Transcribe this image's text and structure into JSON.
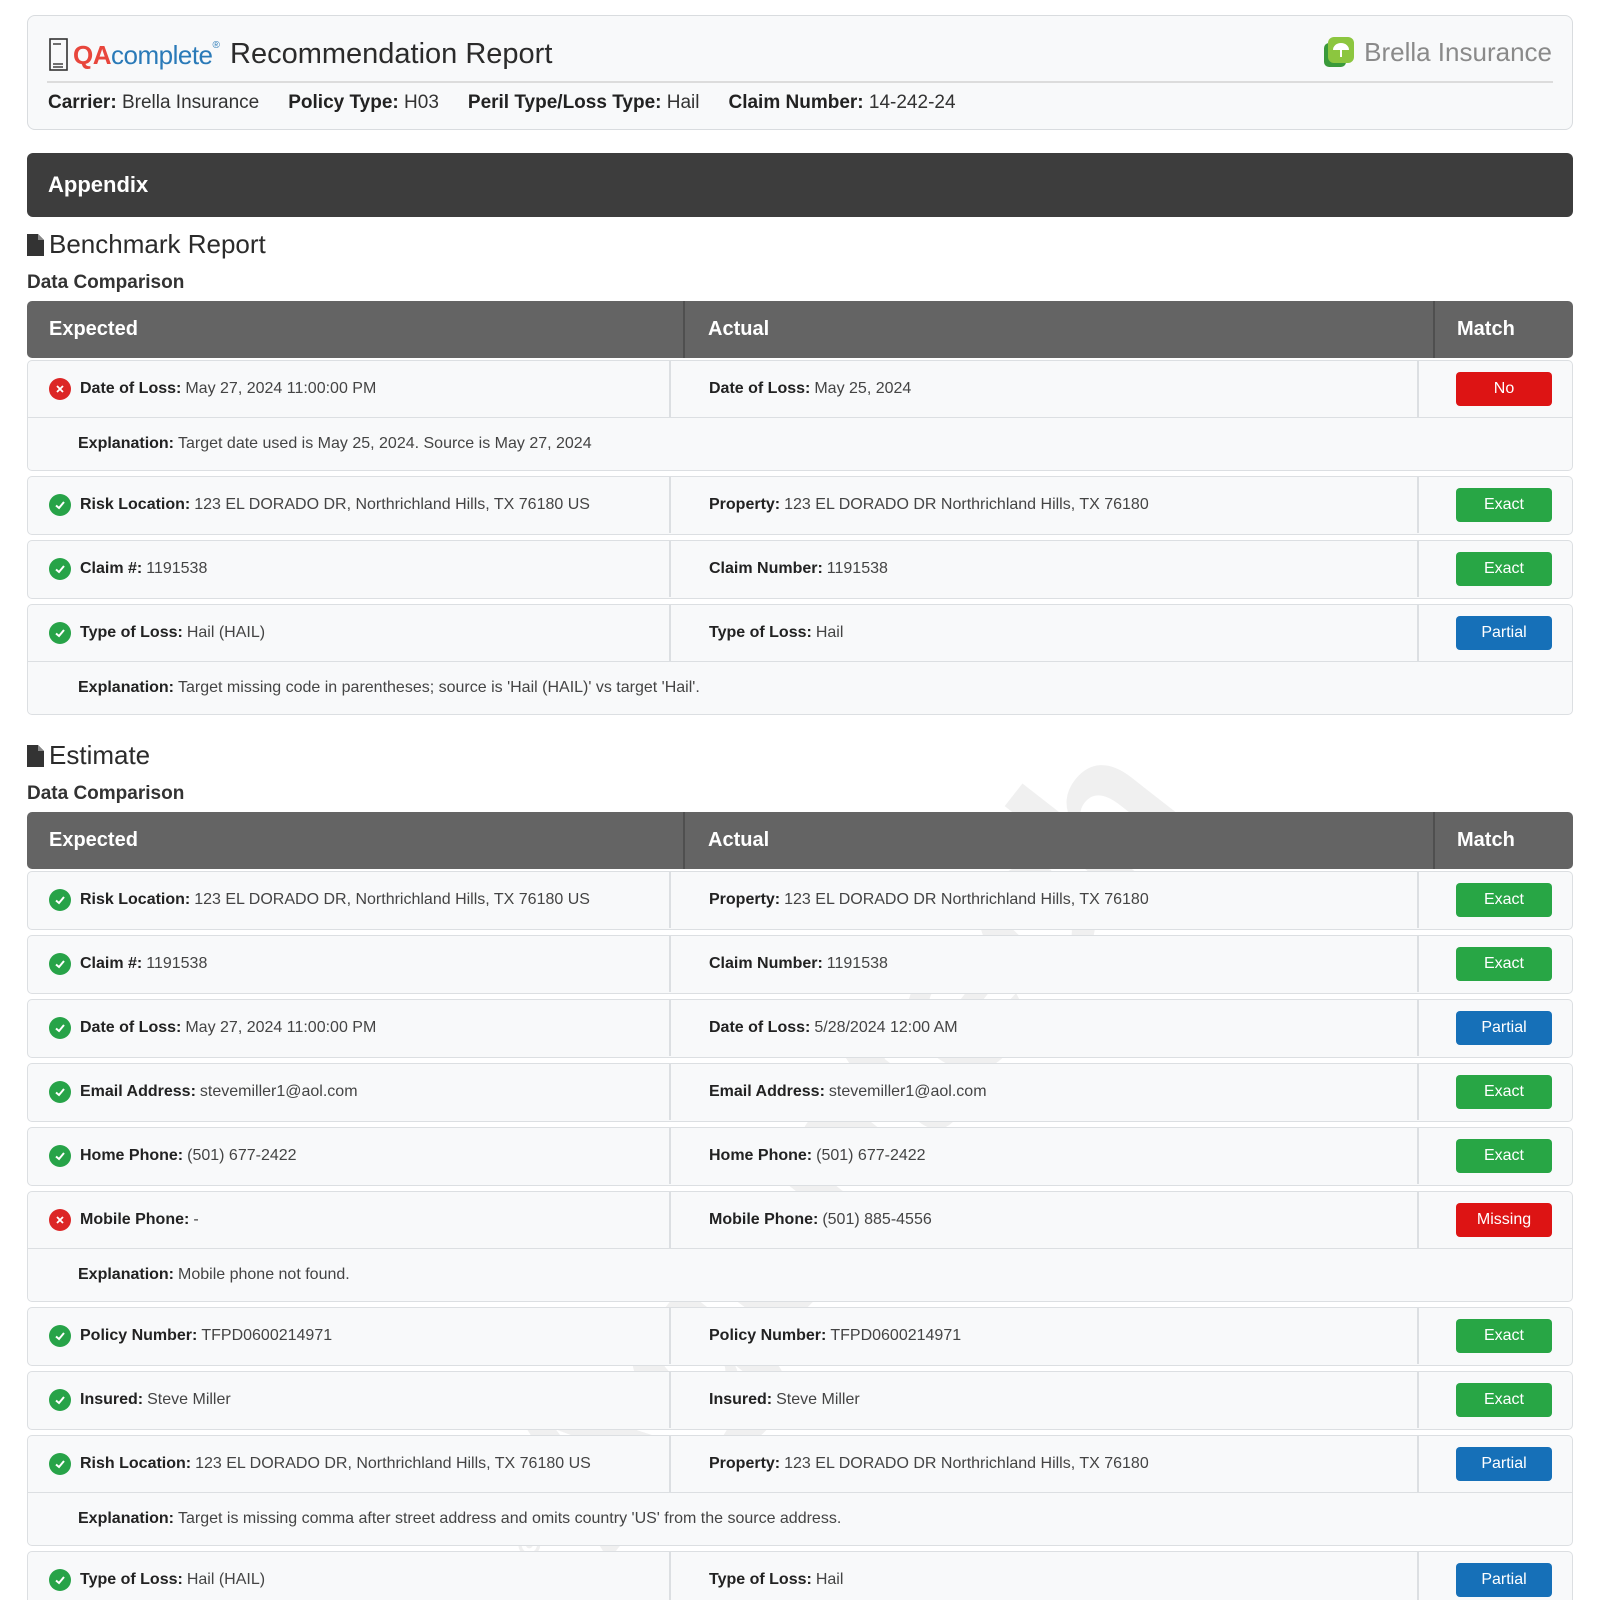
{
  "header": {
    "logo_qa": "QA",
    "logo_complete": "complete",
    "logo_reg": "®",
    "title": "Recommendation Report",
    "brand_name": "Brella Insurance",
    "meta": [
      {
        "label": "Carrier:",
        "value": "Brella Insurance"
      },
      {
        "label": "Policy Type:",
        "value": "H03"
      },
      {
        "label": "Peril Type/Loss Type:",
        "value": "Hail"
      },
      {
        "label": "Claim Number:",
        "value": "14-242-24"
      }
    ]
  },
  "appendix_title": "Appendix",
  "watermark_text": "Agentech",
  "columns": {
    "expected": "Expected",
    "actual": "Actual",
    "match": "Match"
  },
  "benchmark": {
    "title": "Benchmark Report",
    "subtitle": "Data Comparison",
    "rows": [
      {
        "status": "error",
        "exp_label": "Date of Loss:",
        "exp_value": "May 27, 2024 11:00:00 PM",
        "act_label": "Date of Loss:",
        "act_value": "May 25, 2024",
        "match": "No",
        "explanation_label": "Explanation:",
        "explanation": "Target date used is May 25, 2024. Source is May 27, 2024"
      },
      {
        "status": "ok",
        "exp_label": "Risk Location:",
        "exp_value": "123 EL DORADO DR, Northrichland Hills, TX 76180 US",
        "act_label": "Property:",
        "act_value": "123 EL DORADO DR Northrichland Hills, TX 76180",
        "match": "Exact"
      },
      {
        "status": "ok",
        "exp_label": "Claim #:",
        "exp_value": "1191538",
        "act_label": "Claim Number:",
        "act_value": "1191538",
        "match": "Exact"
      },
      {
        "status": "ok",
        "exp_label": "Type of Loss:",
        "exp_value": "Hail (HAIL)",
        "act_label": "Type of Loss:",
        "act_value": "Hail",
        "match": "Partial",
        "explanation_label": "Explanation:",
        "explanation": "Target missing code in parentheses; source is 'Hail (HAIL)' vs target 'Hail'."
      }
    ]
  },
  "estimate": {
    "title": "Estimate",
    "subtitle": "Data Comparison",
    "rows": [
      {
        "status": "ok",
        "exp_label": "Risk Location:",
        "exp_value": "123 EL DORADO DR, Northrichland Hills, TX 76180 US",
        "act_label": "Property:",
        "act_value": "123 EL DORADO DR Northrichland Hills, TX 76180",
        "match": "Exact"
      },
      {
        "status": "ok",
        "exp_label": "Claim #:",
        "exp_value": "1191538",
        "act_label": "Claim Number:",
        "act_value": "1191538",
        "match": "Exact"
      },
      {
        "status": "ok",
        "exp_label": "Date of Loss:",
        "exp_value": "May 27, 2024 11:00:00 PM",
        "act_label": "Date of Loss:",
        "act_value": "5/28/2024 12:00 AM",
        "match": "Partial"
      },
      {
        "status": "ok",
        "exp_label": "Email Address:",
        "exp_value": "stevemiller1@aol.com",
        "act_label": "Email Address:",
        "act_value": "stevemiller1@aol.com",
        "match": "Exact"
      },
      {
        "status": "ok",
        "exp_label": "Home Phone:",
        "exp_value": "(501) 677-2422",
        "act_label": "Home Phone:",
        "act_value": "(501) 677-2422",
        "match": "Exact"
      },
      {
        "status": "error",
        "exp_label": "Mobile Phone:",
        "exp_value": "-",
        "act_label": "Mobile Phone:",
        "act_value": "(501) 885-4556",
        "match": "Missing",
        "explanation_label": "Explanation:",
        "explanation": "Mobile phone not found."
      },
      {
        "status": "ok",
        "exp_label": "Policy Number:",
        "exp_value": "TFPD0600214971",
        "act_label": "Policy Number:",
        "act_value": "TFPD0600214971",
        "match": "Exact"
      },
      {
        "status": "ok",
        "exp_label": "Insured:",
        "exp_value": "Steve Miller",
        "act_label": "Insured:",
        "act_value": "Steve Miller",
        "match": "Exact"
      },
      {
        "status": "ok",
        "exp_label": "Rish Location:",
        "exp_value": "123 EL DORADO DR, Northrichland Hills, TX 76180 US",
        "act_label": "Property:",
        "act_value": "123 EL DORADO DR Northrichland Hills, TX 76180",
        "match": "Partial",
        "explanation_label": "Explanation:",
        "explanation": "Target is missing comma after street address and omits country 'US' from the source address."
      },
      {
        "status": "ok",
        "exp_label": "Type of Loss:",
        "exp_value": "Hail (HAIL)",
        "act_label": "Type of Loss:",
        "act_value": "Hail",
        "match": "Partial"
      }
    ]
  },
  "colors": {
    "exact": "#28a645",
    "partial": "#1670b8",
    "no": "#dd1414",
    "header_bar": "#3d3d3d",
    "table_head": "#646464"
  }
}
